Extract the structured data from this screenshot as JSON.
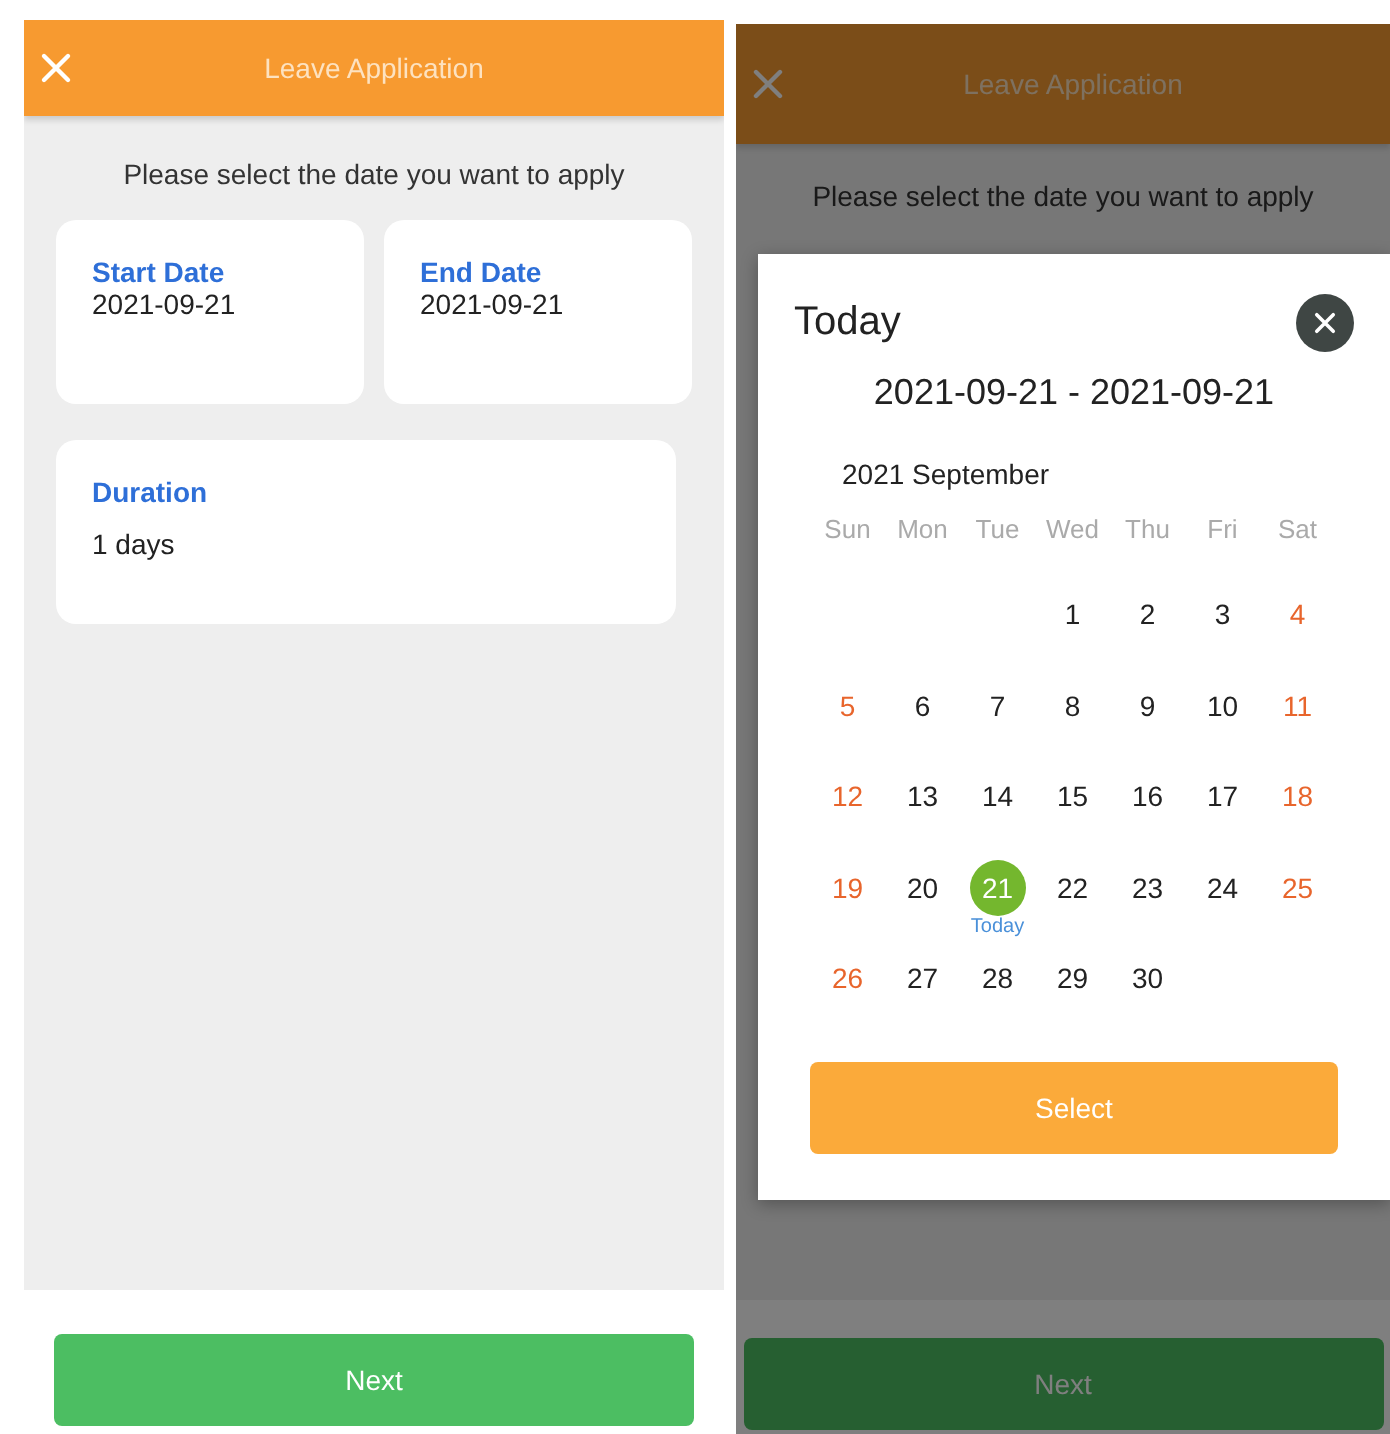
{
  "screens": [
    {
      "header": {
        "title": "Leave Application"
      },
      "prompt": "Please select the date you want to apply",
      "dates": [
        {
          "label": "Start Date",
          "value": "2021-09-21"
        },
        {
          "label": "End Date",
          "value": "2021-09-21"
        }
      ],
      "duration": {
        "label": "Duration",
        "value": "1 days"
      },
      "next_button": "Next",
      "dimmed": false
    },
    {
      "header": {
        "title": "Leave Application"
      },
      "prompt": "Please select the date you want to apply",
      "next_button": "Next",
      "dimmed": true,
      "date_picker": {
        "title": "Today",
        "range": "2021-09-21 - 2021-09-21",
        "month": "2021 September",
        "weekdays": [
          "Sun",
          "Mon",
          "Tue",
          "Wed",
          "Thu",
          "Fri",
          "Sat"
        ],
        "weeks": [
          {
            "kind": "first",
            "days": [
              {
                "day": "1",
                "kind": "weekday",
                "selected": false
              },
              {
                "day": "2",
                "kind": "weekday",
                "selected": false
              },
              {
                "day": "3",
                "kind": "weekday",
                "selected": false
              },
              {
                "day": "4",
                "kind": "weekend",
                "selected": false
              }
            ]
          },
          {
            "kind": "full",
            "days": [
              {
                "day": "5",
                "kind": "weekend",
                "selected": false
              },
              {
                "day": "6",
                "kind": "weekday",
                "selected": false
              },
              {
                "day": "7",
                "kind": "weekday",
                "selected": false
              },
              {
                "day": "8",
                "kind": "weekday",
                "selected": false
              },
              {
                "day": "9",
                "kind": "weekday",
                "selected": false
              },
              {
                "day": "10",
                "kind": "weekday",
                "selected": false
              },
              {
                "day": "11",
                "kind": "weekend",
                "selected": false
              }
            ]
          },
          {
            "kind": "full",
            "days": [
              {
                "day": "12",
                "kind": "weekend",
                "selected": false
              },
              {
                "day": "13",
                "kind": "weekday",
                "selected": false
              },
              {
                "day": "14",
                "kind": "weekday",
                "selected": false
              },
              {
                "day": "15",
                "kind": "weekday",
                "selected": false
              },
              {
                "day": "16",
                "kind": "weekday",
                "selected": false
              },
              {
                "day": "17",
                "kind": "weekday",
                "selected": false
              },
              {
                "day": "18",
                "kind": "weekend",
                "selected": false
              }
            ]
          },
          {
            "kind": "full",
            "days": [
              {
                "day": "19",
                "kind": "weekend",
                "selected": false
              },
              {
                "day": "20",
                "kind": "weekday",
                "selected": false
              },
              {
                "day": "21",
                "kind": "weekday",
                "selected": true,
                "note": "Today"
              },
              {
                "day": "22",
                "kind": "weekday",
                "selected": false
              },
              {
                "day": "23",
                "kind": "weekday",
                "selected": false
              },
              {
                "day": "24",
                "kind": "weekday",
                "selected": false
              },
              {
                "day": "25",
                "kind": "weekend",
                "selected": false
              }
            ]
          },
          {
            "kind": "last",
            "days": [
              {
                "day": "26",
                "kind": "weekend",
                "selected": false
              },
              {
                "day": "27",
                "kind": "weekday",
                "selected": false
              },
              {
                "day": "28",
                "kind": "weekday",
                "selected": false
              },
              {
                "day": "29",
                "kind": "weekday",
                "selected": false
              },
              {
                "day": "30",
                "kind": "weekday",
                "selected": false
              }
            ]
          }
        ],
        "select_button": "Select"
      }
    }
  ]
}
